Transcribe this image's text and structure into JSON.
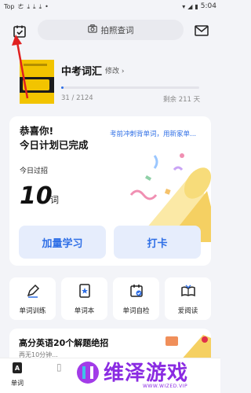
{
  "status_bar": {
    "left_icons": [
      "Top",
      "ㄜ"
    ],
    "time": "5:04"
  },
  "search": {
    "label": "拍照查词"
  },
  "book": {
    "title": "中考词汇",
    "edit_label": "修改",
    "progress_count": "31 / 2124",
    "progress_remaining": "剩余 211 天",
    "progress_fraction": 0.015
  },
  "main_card": {
    "congrats_line1": "恭喜你!",
    "congrats_line2": "今日计划已完成",
    "promo": "考前冲刺背单词，用新家单...",
    "today_label": "今日过招",
    "today_count": "10",
    "today_unit": "词",
    "btn_study": "加量学习",
    "btn_checkin": "打卡"
  },
  "tools": [
    {
      "label": "单词训练",
      "icon": "pencil-icon"
    },
    {
      "label": "单词本",
      "icon": "star-book-icon"
    },
    {
      "label": "单词自检",
      "icon": "calendar-check-icon"
    },
    {
      "label": "爱阅读",
      "icon": "open-book-icon"
    }
  ],
  "banner": {
    "title": "高分英语20个解题绝招",
    "subtitle": "再无10分钟..."
  },
  "bottom_nav": {
    "home_label": "单词"
  },
  "watermark": {
    "text": "维泽游戏",
    "sub": "WWW.WIZED.VIP"
  },
  "colors": {
    "accent": "#2f6fe6",
    "annotation": "#e02020",
    "watermark": "#8a2be2"
  }
}
